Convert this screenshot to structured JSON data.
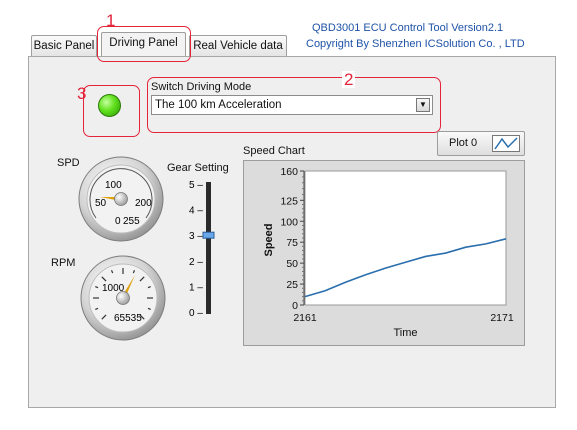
{
  "window": {
    "title_line1": "QBD3001 ECU Control Tool Version2.1",
    "title_line2": "Copyright By Shenzhen ICSolution Co. , LTD"
  },
  "tabs": [
    {
      "label": "Basic Panel",
      "active": false
    },
    {
      "label": "Driving Panel",
      "active": true
    },
    {
      "label": "Real Vehicle data",
      "active": false
    }
  ],
  "callouts": {
    "one": "1",
    "two": "2",
    "three": "3"
  },
  "colors": {
    "callout": "#e3243b",
    "header_text": "#1f53a8",
    "plot_line": "#2a6ead",
    "led_on": "#5fe01b"
  },
  "status_led": {
    "icon": "led-indicator-icon",
    "state": "on"
  },
  "driving_mode": {
    "label": "Switch Driving Mode",
    "selected": "The 100 km Acceleration"
  },
  "spd_gauge": {
    "label": "SPD",
    "min": 0,
    "max": 255,
    "tick_labels": [
      "0",
      "50",
      "100",
      "200",
      "255"
    ],
    "value": 100
  },
  "rpm_gauge": {
    "label": "RPM",
    "min": 0,
    "max": 65535,
    "value_label": "1000",
    "max_label": "65535",
    "value": 1000
  },
  "gear_setting": {
    "label": "Gear Setting",
    "ticks": [
      "5",
      "4",
      "3",
      "2",
      "1",
      "0"
    ],
    "value": 3
  },
  "speed_chart": {
    "title": "Speed Chart",
    "legend_label": "Plot 0"
  },
  "chart_data": {
    "type": "line",
    "title": "Speed Chart",
    "xlabel": "Time",
    "ylabel": "Speed",
    "xlim": [
      2161,
      2171
    ],
    "ylim": [
      0,
      160
    ],
    "x_tick_labels": [
      "2161",
      "2171"
    ],
    "y_ticks": [
      0,
      25,
      50,
      75,
      100,
      125,
      150
    ],
    "y_tick_labels": [
      "0",
      "25",
      "50",
      "75",
      "100",
      "125",
      "160"
    ],
    "series": [
      {
        "name": "Plot 0",
        "x": [
          2161,
          2162,
          2163,
          2164,
          2165,
          2166,
          2167,
          2168,
          2169,
          2170,
          2171
        ],
        "y": [
          10,
          17,
          27,
          36,
          44,
          51,
          58,
          62,
          69,
          73,
          79
        ]
      }
    ]
  }
}
